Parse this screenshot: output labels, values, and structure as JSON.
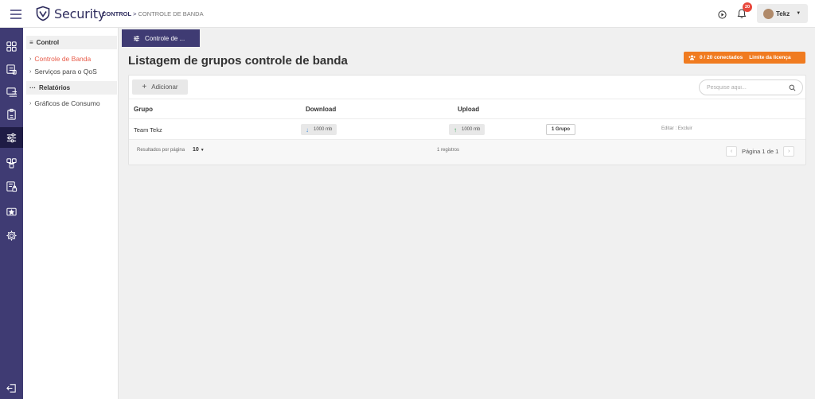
{
  "header": {
    "brand": "Security",
    "breadcrumb_main": "CONTROL",
    "breadcrumb_sep": ">",
    "breadcrumb_sub": "CONTROLE DE BANDA",
    "notification_count": "20",
    "user_name": "Tekz"
  },
  "rail": {
    "icons": [
      "dashboard-icon",
      "device-list-icon",
      "monitor-list-icon",
      "clipboard-icon",
      "sliders-icon",
      "users-network-icon",
      "lock-document-icon",
      "star-card-icon",
      "gear-icon"
    ],
    "active_index": 4,
    "logout_icon": "logout-icon"
  },
  "sidebar": {
    "section_control": "Control",
    "items_control": [
      "Controle de Banda",
      "Serviços para o QoS"
    ],
    "section_relatorios": "Relatórios",
    "items_relatorios": [
      "Gráficos de Consumo"
    ]
  },
  "main": {
    "tab_label": "Controle de ...",
    "title": "Listagem de grupos controle de banda",
    "license_text": "0 / 20 conectados",
    "license_link": "Limite da licença",
    "add_label": "Adicionar",
    "search_placeholder": "Pesquise aqui...",
    "columns": [
      "Grupo",
      "Download",
      "Upload"
    ],
    "rows": [
      {
        "grupo": "Team Tekz",
        "download": "1000 mb",
        "upload": "1000 mb",
        "groups": "1 Grupo",
        "edit": "Editar",
        "sep": " : ",
        "delete": "Excluir"
      }
    ],
    "per_page_label": "Resultados por página",
    "per_page_value": "10",
    "records": "1 registros",
    "page_label": "Página 1 de 1"
  },
  "colors": {
    "accent": "#3f3b73",
    "active_link": "#e85c4a",
    "license_bg": "#f07b20",
    "badge": "#e8473b"
  }
}
